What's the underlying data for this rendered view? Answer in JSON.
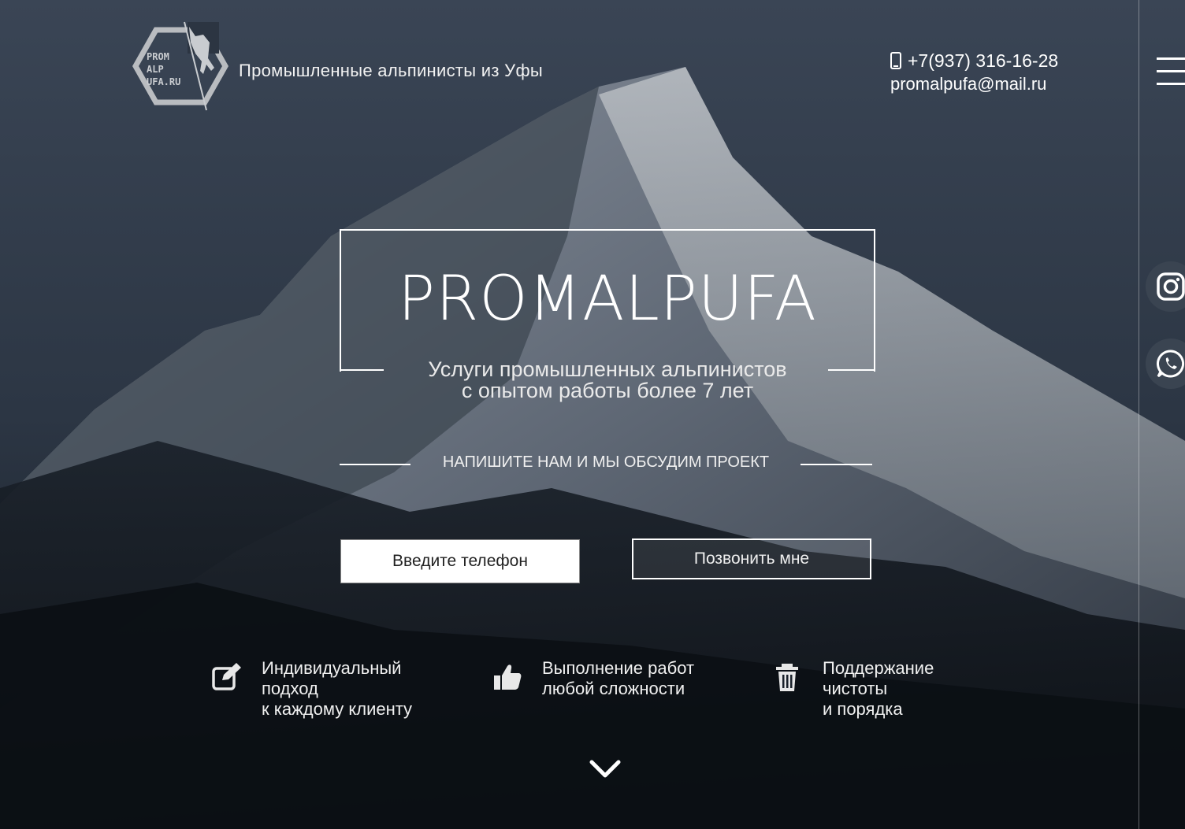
{
  "header": {
    "logo_text": [
      "PROM",
      "ALP",
      "UFA.RU"
    ],
    "tagline": "Промышленные альпинисты из Уфы",
    "phone": "+7(937) 316-16-28",
    "email": "promalpufa@mail.ru"
  },
  "hero": {
    "brand": "PROMALPUFA",
    "subtitle_line1": "Услуги промышленных альпинистов",
    "subtitle_line2": "с опытом работы более 7 лет",
    "cta": "НАПИШИТЕ НАМ И МЫ ОБСУДИМ ПРОЕКТ"
  },
  "form": {
    "phone_placeholder": "Введите телефон",
    "call_button": "Позвонить мне"
  },
  "features": [
    {
      "icon": "edit-icon",
      "lines": [
        "Индивидуальный",
        "подход",
        "к каждому клиенту"
      ]
    },
    {
      "icon": "thumbs-up-icon",
      "lines": [
        "Выполнение работ",
        "любой сложности"
      ]
    },
    {
      "icon": "trash-icon",
      "lines": [
        "Поддержание",
        "чистоты",
        "и порядка"
      ]
    }
  ],
  "social": [
    "instagram-icon",
    "whatsapp-icon"
  ],
  "colors": {
    "background": "#1f2733",
    "accent": "#ffffff"
  }
}
